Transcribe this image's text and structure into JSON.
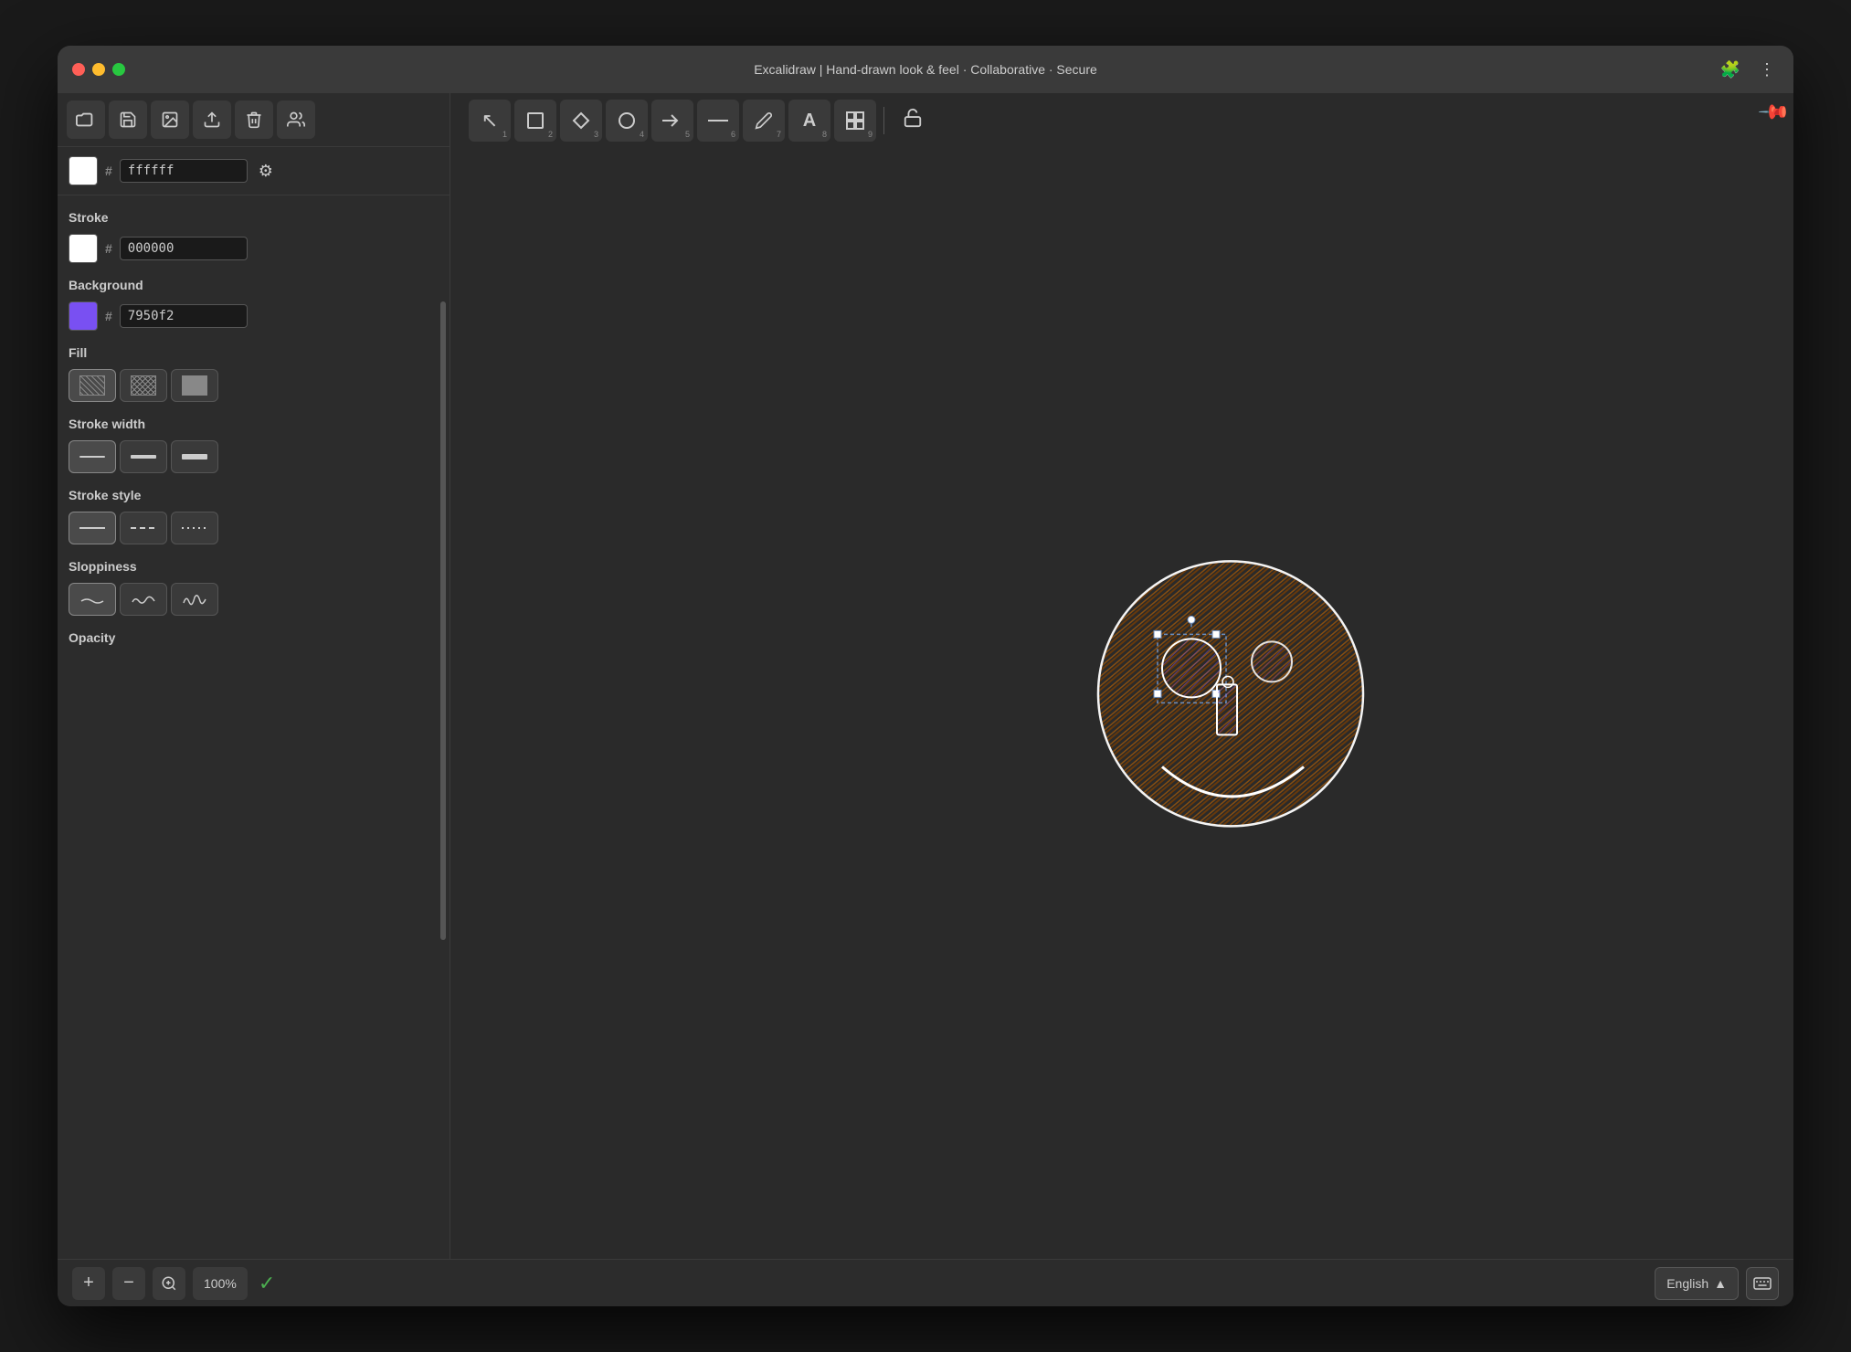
{
  "window": {
    "title": "Excalidraw | Hand-drawn look & feel · Collaborative · Secure"
  },
  "titlebar": {
    "title": "Excalidraw | Hand-drawn look & feel · Collaborative · Secure",
    "traffic_lights": [
      "red",
      "yellow",
      "green"
    ]
  },
  "toolbar_left": {
    "buttons": [
      {
        "name": "open-folder",
        "icon": "📂",
        "label": "Open"
      },
      {
        "name": "save",
        "icon": "💾",
        "label": "Save"
      },
      {
        "name": "export-image",
        "icon": "🖼️",
        "label": "Export image"
      },
      {
        "name": "export",
        "icon": "📤",
        "label": "Export"
      },
      {
        "name": "clear",
        "icon": "🗑️",
        "label": "Clear canvas"
      },
      {
        "name": "share",
        "icon": "👥",
        "label": "Share"
      }
    ]
  },
  "canvas_toolbar": {
    "tools": [
      {
        "name": "select",
        "icon": "↖",
        "num": "1"
      },
      {
        "name": "rectangle",
        "icon": "□",
        "num": "2"
      },
      {
        "name": "diamond",
        "icon": "◇",
        "num": "3"
      },
      {
        "name": "ellipse",
        "icon": "○",
        "num": "4"
      },
      {
        "name": "arrow",
        "icon": "→",
        "num": "5"
      },
      {
        "name": "line",
        "icon": "—",
        "num": "6"
      },
      {
        "name": "pencil",
        "icon": "✏",
        "num": "7"
      },
      {
        "name": "text",
        "icon": "A",
        "num": "8"
      },
      {
        "name": "image",
        "icon": "⊞",
        "num": "9"
      }
    ]
  },
  "color_bar": {
    "swatch_color": "#ffffff",
    "hash": "#",
    "value": "ffffff",
    "settings_icon": "⚙"
  },
  "stroke": {
    "label": "Stroke",
    "swatch_color": "#ffffff",
    "hash": "#",
    "value": "000000"
  },
  "background": {
    "label": "Background",
    "swatch_color": "#7950f2",
    "hash": "#",
    "value": "7950f2"
  },
  "fill": {
    "label": "Fill",
    "options": [
      "hatch",
      "cross-hatch",
      "solid"
    ]
  },
  "stroke_width": {
    "label": "Stroke width",
    "options": [
      "thin",
      "medium",
      "thick"
    ]
  },
  "stroke_style": {
    "label": "Stroke style",
    "options": [
      "solid",
      "dashed",
      "dotted"
    ]
  },
  "sloppiness": {
    "label": "Sloppiness",
    "options": [
      "architect",
      "artist",
      "cartoonist"
    ]
  },
  "opacity": {
    "label": "Opacity"
  },
  "bottom_bar": {
    "zoom_in": "+",
    "zoom_out": "−",
    "zoom_fit": "⊙",
    "zoom_value": "100%",
    "status": "✓",
    "language": "English",
    "language_arrow": "▲",
    "keyboard_icon": "⌨"
  }
}
